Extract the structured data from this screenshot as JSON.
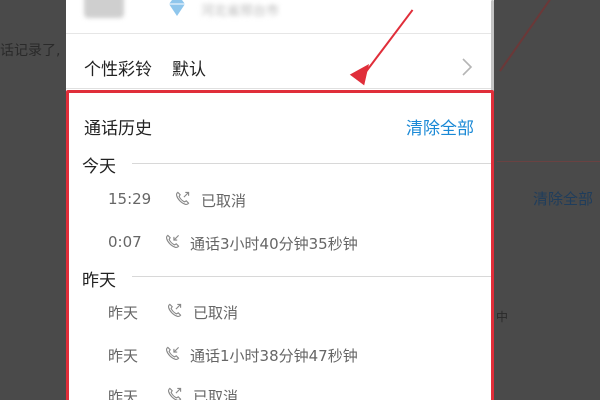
{
  "background": {
    "left_text": "话记录了,",
    "right_link": "清除全部",
    "right_small": "中"
  },
  "profile": {
    "avatar": "avatar",
    "verified_icon": "diamond-icon",
    "name": "河北省邢台市"
  },
  "ringback": {
    "label": "个性彩铃",
    "value": "默认",
    "chevron_icon": "chevron-right-icon"
  },
  "history": {
    "title": "通话历史",
    "clear_all": "清除全部",
    "sections": [
      {
        "label": "今天",
        "calls": [
          {
            "time": "15:29",
            "icon": "outgoing-call-icon",
            "status": "已取消"
          },
          {
            "time": "0:07",
            "icon": "incoming-call-icon",
            "status": "通话3小时40分钟35秒钟"
          }
        ]
      },
      {
        "label": "昨天",
        "calls": [
          {
            "time": "昨天",
            "icon": "outgoing-call-icon",
            "status": "已取消"
          },
          {
            "time": "昨天",
            "icon": "incoming-call-icon",
            "status": "通话1小时38分钟47秒钟"
          },
          {
            "time": "昨天",
            "icon": "outgoing-call-icon",
            "status": "已取消"
          }
        ]
      }
    ]
  },
  "annotation": {
    "color": "#e02e3a"
  },
  "colors": {
    "accent_link": "#1a89d6",
    "overlay": "#4a4a4a"
  }
}
